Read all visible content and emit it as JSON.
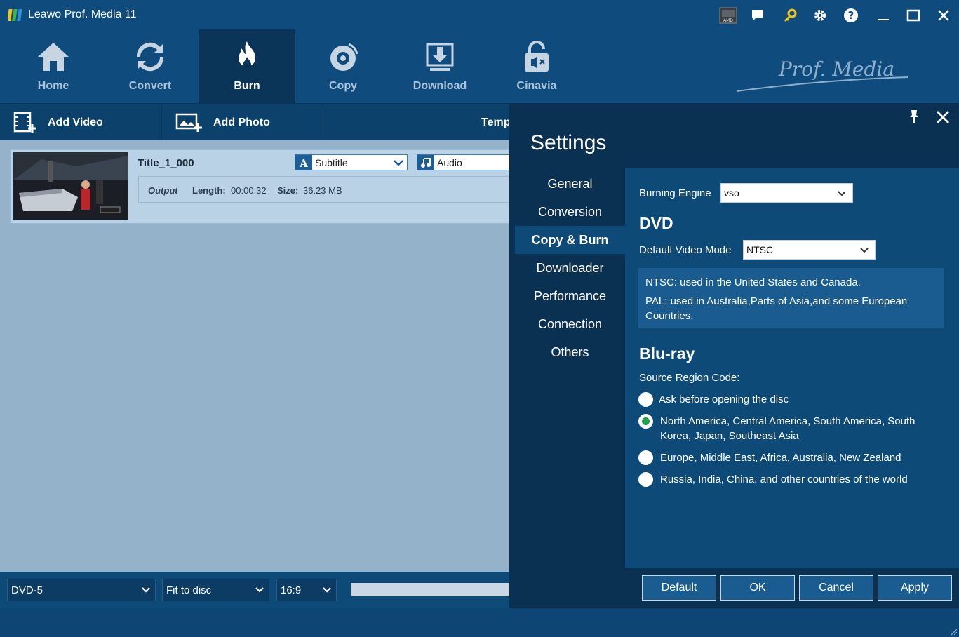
{
  "window": {
    "title": "Leawo Prof. Media 11"
  },
  "nav": [
    {
      "label": "Home"
    },
    {
      "label": "Convert"
    },
    {
      "label": "Burn"
    },
    {
      "label": "Copy"
    },
    {
      "label": "Download"
    },
    {
      "label": "Cinavia"
    }
  ],
  "brand": {
    "text": "Prof. Media"
  },
  "toolbar": {
    "add_video": "Add Video",
    "add_photo": "Add Photo",
    "template": "Temp"
  },
  "video": {
    "title": "Title_1_000",
    "subtitle_value": "Subtitle",
    "audio_value": "Audio",
    "output_label": "Output",
    "length_label": "Length:",
    "length_value": "00:00:32",
    "size_label": "Size:",
    "size_value": "36.23 MB"
  },
  "bottom": {
    "disc_type": "DVD-5",
    "fit": "Fit to disc",
    "aspect": "16:9"
  },
  "settings": {
    "title": "Settings",
    "menu": [
      "General",
      "Conversion",
      "Copy & Burn",
      "Downloader",
      "Performance",
      "Connection",
      "Others"
    ],
    "active_menu": "Copy & Burn",
    "burning_engine_label": "Burning Engine",
    "burning_engine_value": "vso",
    "dvd_heading": "DVD",
    "video_mode_label": "Default Video Mode",
    "video_mode_value": "NTSC",
    "info_ntsc": "NTSC: used in the United States and Canada.",
    "info_pal": "PAL: used in Australia,Parts of Asia,and some European Countries.",
    "bluray_heading": "Blu-ray",
    "region_label": "Source Region Code:",
    "regions": [
      {
        "label": "Ask before opening the disc",
        "checked": false
      },
      {
        "label": "North America, Central America, South America, South Korea, Japan, Southeast Asia",
        "checked": true
      },
      {
        "label": "Europe, Middle East, Africa, Australia, New Zealand",
        "checked": false
      },
      {
        "label": "Russia, India, China, and other countries of the world",
        "checked": false
      }
    ],
    "buttons": {
      "default": "Default",
      "ok": "OK",
      "cancel": "Cancel",
      "apply": "Apply"
    }
  }
}
